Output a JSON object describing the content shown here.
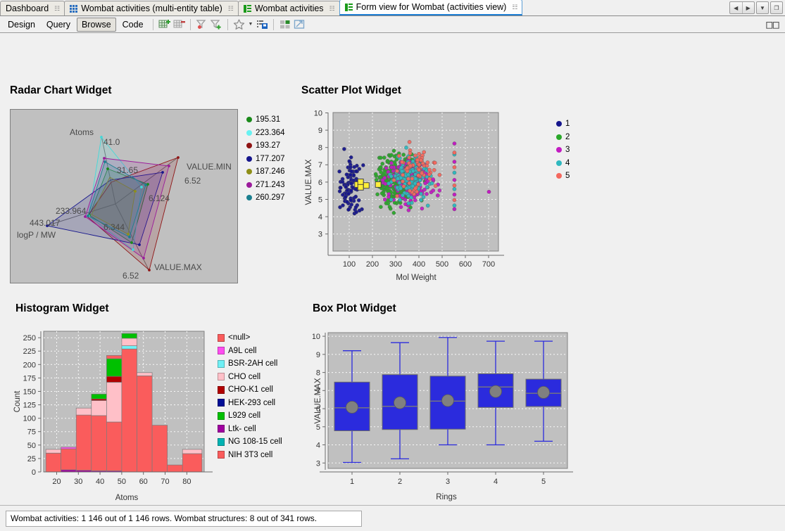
{
  "window": {
    "controls": [
      {
        "name": "scroll-left",
        "glyph": "◀"
      },
      {
        "name": "scroll-right",
        "glyph": "▶"
      },
      {
        "name": "tab-list-dropdown",
        "glyph": "▼"
      },
      {
        "name": "restore-window",
        "glyph": "❐"
      }
    ]
  },
  "tabs": [
    {
      "label": "Dashboard",
      "icon": "none",
      "active": false,
      "closable": true
    },
    {
      "label": "Wombat activities (multi-entity table)",
      "icon": "grid-icon",
      "active": false,
      "closable": true
    },
    {
      "label": "Wombat activities",
      "icon": "form-icon",
      "active": false,
      "closable": true
    },
    {
      "label": "Form view for Wombat (activities view)",
      "icon": "form-icon",
      "active": true,
      "closable": true
    }
  ],
  "toolbar": {
    "modes": [
      {
        "label": "Design",
        "pressed": false
      },
      {
        "label": "Query",
        "pressed": false
      },
      {
        "label": "Browse",
        "pressed": true
      },
      {
        "label": "Code",
        "pressed": false
      }
    ],
    "icons": [
      {
        "name": "add-row-icon"
      },
      {
        "name": "delete-row-icon"
      },
      {
        "name": "filter-remove-icon"
      },
      {
        "name": "filter-add-icon"
      },
      {
        "name": "favorite-star-icon"
      },
      {
        "name": "favorite-dropdown-caret"
      },
      {
        "name": "save-form-icon"
      },
      {
        "name": "layout-icon"
      },
      {
        "name": "expand-icon"
      },
      {
        "name": "book-icon"
      }
    ]
  },
  "widgets": {
    "radar_title": "Radar Chart Widget",
    "scatter_title": "Scatter Plot Widget",
    "histogram_title": "Histogram Widget",
    "boxplot_title": "Box Plot Widget"
  },
  "status": {
    "text": "Wombat activities: 1 146 out of 1 146 rows. Wombat structures: 8 out of 341 rows."
  },
  "colors": {
    "plot_bg": "#c0c0c0",
    "page_bg": "#f0f0f0",
    "accent": "#1e7fd4",
    "box_fill": "#2b2bdd",
    "box_mean": "#808080"
  },
  "chart_data": [
    {
      "type": "radar",
      "title": "Radar Chart Widget",
      "axes": [
        "Atoms",
        "VALUE.MIN",
        "VALUE.MAX",
        "logP / MW"
      ],
      "axis_value_labels": [
        "41.0",
        "31.65",
        "6.52",
        "6.124",
        "6.52",
        "6.344",
        "233.964",
        "443.017"
      ],
      "legend_position": "right",
      "series": [
        {
          "name": "195.31",
          "color": "#1a8a1a",
          "values": [
            0.52,
            0.62,
            0.3,
            0.33
          ]
        },
        {
          "name": "223.364",
          "color": "#68f2f2",
          "values": [
            1.0,
            0.55,
            0.45,
            0.32
          ]
        },
        {
          "name": "193.27",
          "color": "#8f1414",
          "values": [
            0.3,
            0.96,
            0.98,
            0.34
          ]
        },
        {
          "name": "177.207",
          "color": "#16168c",
          "values": [
            0.33,
            0.86,
            0.62,
            1.0
          ]
        },
        {
          "name": "187.246",
          "color": "#8f8f18",
          "values": [
            0.38,
            0.5,
            0.36,
            0.3
          ]
        },
        {
          "name": "271.243",
          "color": "#9b1b9b",
          "values": [
            0.62,
            0.78,
            0.72,
            0.36
          ]
        },
        {
          "name": "260.297",
          "color": "#1a7f8f",
          "values": [
            0.66,
            0.58,
            0.38,
            0.33
          ]
        }
      ]
    },
    {
      "type": "scatter",
      "title": "Scatter Plot Widget",
      "xlabel": "Mol Weight",
      "ylabel": "VALUE.MAX",
      "xticks": [
        100,
        200,
        300,
        400,
        500,
        600,
        700
      ],
      "yticks": [
        3,
        4,
        5,
        6,
        7,
        8,
        9,
        10
      ],
      "xlim": [
        75,
        770
      ],
      "ylim": [
        2.7,
        10.3
      ],
      "grid": true,
      "legend_position": "right",
      "legend": [
        {
          "name": "1",
          "color": "#16168c"
        },
        {
          "name": "2",
          "color": "#2aa82a"
        },
        {
          "name": "3",
          "color": "#c21cc2"
        },
        {
          "name": "4",
          "color": "#2fb8bf"
        },
        {
          "name": "5",
          "color": "#f4685e"
        }
      ],
      "selection_marker": {
        "color": "#ffef3a",
        "shape": "square",
        "count": 5
      },
      "point_count": 1146
    },
    {
      "type": "histogram",
      "title": "Histogram Widget",
      "xlabel": "Atoms",
      "ylabel": "Count",
      "xticks": [
        20,
        30,
        40,
        50,
        60,
        70,
        80
      ],
      "yticks": [
        0,
        25,
        50,
        75,
        100,
        125,
        150,
        175,
        200,
        225,
        250
      ],
      "xlim": [
        14,
        88
      ],
      "ylim": [
        0,
        262
      ],
      "grid": true,
      "legend_position": "right",
      "categories": [
        "<null>",
        "A9L cell",
        "BSR-2AH cell",
        "CHO cell",
        "CHO-K1 cell",
        "HEK-293 cell",
        "L929 cell",
        "Ltk- cell",
        "NG 108-15 cell",
        "NIH 3T3 cell"
      ],
      "category_colors": [
        "#fa5c5c",
        "#ff4df0",
        "#6ff0f5",
        "#ffc0c8",
        "#b20000",
        "#000f96",
        "#00c000",
        "#a000a0",
        "#00b3b3",
        "#fa5c5c"
      ],
      "bins": [
        {
          "bin": "15-22",
          "total": 42,
          "segments": [
            {
              "cat": "<null>",
              "v": 35
            },
            {
              "cat": "CHO cell",
              "v": 7
            }
          ]
        },
        {
          "bin": "22-29",
          "total": 46,
          "segments": [
            {
              "cat": "Ltk- cell",
              "v": 4
            },
            {
              "cat": "<null>",
              "v": 39
            },
            {
              "cat": "A9L cell",
              "v": 3
            }
          ]
        },
        {
          "bin": "29-36",
          "total": 119,
          "segments": [
            {
              "cat": "Ltk- cell",
              "v": 3
            },
            {
              "cat": "<null>",
              "v": 103
            },
            {
              "cat": "CHO cell",
              "v": 13
            }
          ]
        },
        {
          "bin": "36-43",
          "total": 145,
          "segments": [
            {
              "cat": "Ltk- cell",
              "v": 2
            },
            {
              "cat": "<null>",
              "v": 103
            },
            {
              "cat": "CHO cell",
              "v": 28
            },
            {
              "cat": "CHO-K1 cell",
              "v": 3
            },
            {
              "cat": "L929 cell",
              "v": 9
            }
          ]
        },
        {
          "bin": "43-50",
          "total": 217,
          "segments": [
            {
              "cat": "Ltk- cell",
              "v": 2
            },
            {
              "cat": "<null>",
              "v": 91
            },
            {
              "cat": "CHO cell",
              "v": 74
            },
            {
              "cat": "CHO-K1 cell",
              "v": 11
            },
            {
              "cat": "L929 cell",
              "v": 33
            },
            {
              "cat": "NIH 3T3 cell",
              "v": 6
            }
          ]
        },
        {
          "bin": "50-57",
          "total": 258,
          "segments": [
            {
              "cat": "<null>",
              "v": 229
            },
            {
              "cat": "BSR-2AH cell",
              "v": 6
            },
            {
              "cat": "CHO cell",
              "v": 14
            },
            {
              "cat": "L929 cell",
              "v": 9
            }
          ]
        },
        {
          "bin": "57-64",
          "total": 185,
          "segments": [
            {
              "cat": "<null>",
              "v": 179
            },
            {
              "cat": "CHO cell",
              "v": 6
            }
          ]
        },
        {
          "bin": "64-71",
          "total": 87,
          "segments": [
            {
              "cat": "<null>",
              "v": 87
            }
          ]
        },
        {
          "bin": "71-78",
          "total": 13,
          "segments": [
            {
              "cat": "<null>",
              "v": 13
            }
          ]
        },
        {
          "bin": "78-87",
          "total": 42,
          "segments": [
            {
              "cat": "<null>",
              "v": 34
            },
            {
              "cat": "CHO cell",
              "v": 8
            }
          ]
        }
      ]
    },
    {
      "type": "box",
      "title": "Box Plot Widget",
      "xlabel": "Rings",
      "ylabel": "VALUE.MAX",
      "categories": [
        "1",
        "2",
        "3",
        "4",
        "5"
      ],
      "yticks": [
        3,
        4,
        5,
        6,
        7,
        8,
        9,
        10
      ],
      "ylim": [
        2.7,
        10.2
      ],
      "grid": true,
      "boxes": [
        {
          "category": "1",
          "min": 3.03,
          "q1": 4.78,
          "median": 6.05,
          "mean": 6.08,
          "q3": 7.47,
          "max": 9.2
        },
        {
          "category": "2",
          "min": 3.23,
          "q1": 4.85,
          "median": 6.13,
          "mean": 6.33,
          "q3": 7.88,
          "max": 9.65
        },
        {
          "category": "3",
          "min": 4.0,
          "q1": 4.87,
          "median": 6.42,
          "mean": 6.45,
          "q3": 7.8,
          "max": 9.93
        },
        {
          "category": "4",
          "min": 4.0,
          "q1": 6.07,
          "median": 7.2,
          "mean": 6.95,
          "q3": 7.93,
          "max": 9.73
        },
        {
          "category": "5",
          "min": 4.2,
          "q1": 6.12,
          "median": 6.85,
          "mean": 6.9,
          "q3": 7.63,
          "max": 9.73
        }
      ]
    }
  ]
}
